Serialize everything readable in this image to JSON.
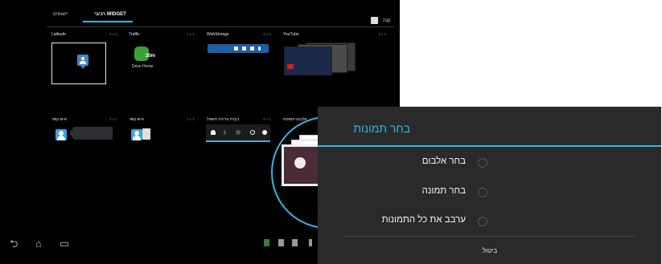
{
  "topbar": {
    "tab_apps": "יישומים",
    "tab_widgets": "רכיבי WIDGET",
    "shop": "קנה"
  },
  "widgets": [
    {
      "name": "Latitude",
      "size": "2 x 2"
    },
    {
      "name": "Traffic",
      "size": "1 x 1"
    },
    {
      "name": "WebStorage",
      "size": "4 x 1"
    },
    {
      "name": "YouTube",
      "size": "3 x 3"
    },
    {
      "name": "איש קשר",
      "size": "2 x 1"
    },
    {
      "name": "איש קשר",
      "size": "1 x 1"
    },
    {
      "name": "בקרת צריכת חשמל",
      "size": "4 x 1"
    },
    {
      "name": "אלבום תמונות",
      "size": "2 x 2"
    }
  ],
  "traffic": {
    "minutes": "20m",
    "destination": "Drive Home"
  },
  "icons": {
    "nav": [
      "back-icon",
      "home-icon",
      "recent-apps-icon"
    ],
    "tray": [
      "gallery-icon",
      "lock-icon",
      "sd-card-icon",
      "usb-icon"
    ]
  },
  "dialog": {
    "title": "בחר תמונות",
    "options": [
      "בחר אלבום",
      "בחר תמונה",
      "ערבב את כל התמונות"
    ],
    "cancel": "ביטול"
  },
  "colors": {
    "accent": "#33b5e5",
    "dialog_bg": "#2a2a2a",
    "screen_bg": "#000000"
  }
}
